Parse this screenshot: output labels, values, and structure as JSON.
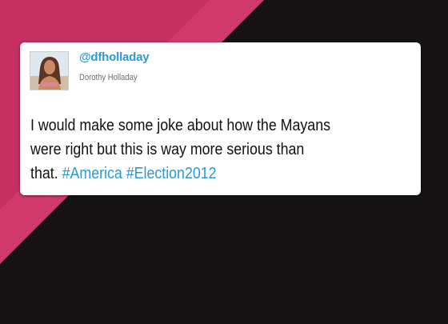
{
  "colors": {
    "background": "#151314",
    "accent_pink": "#d13a6b",
    "link_blue": "#2a9ad3",
    "card": "#ffffff"
  },
  "tweet": {
    "handle": "@dfholladay",
    "display_name": "Dorothy Holladay",
    "avatar_icon": "profile-photo",
    "text_lines": [
      "I would make some joke about how the Mayans",
      "were right but this is way more serious than",
      "that. "
    ],
    "hashtags": [
      "#America",
      "#Election2012"
    ]
  }
}
